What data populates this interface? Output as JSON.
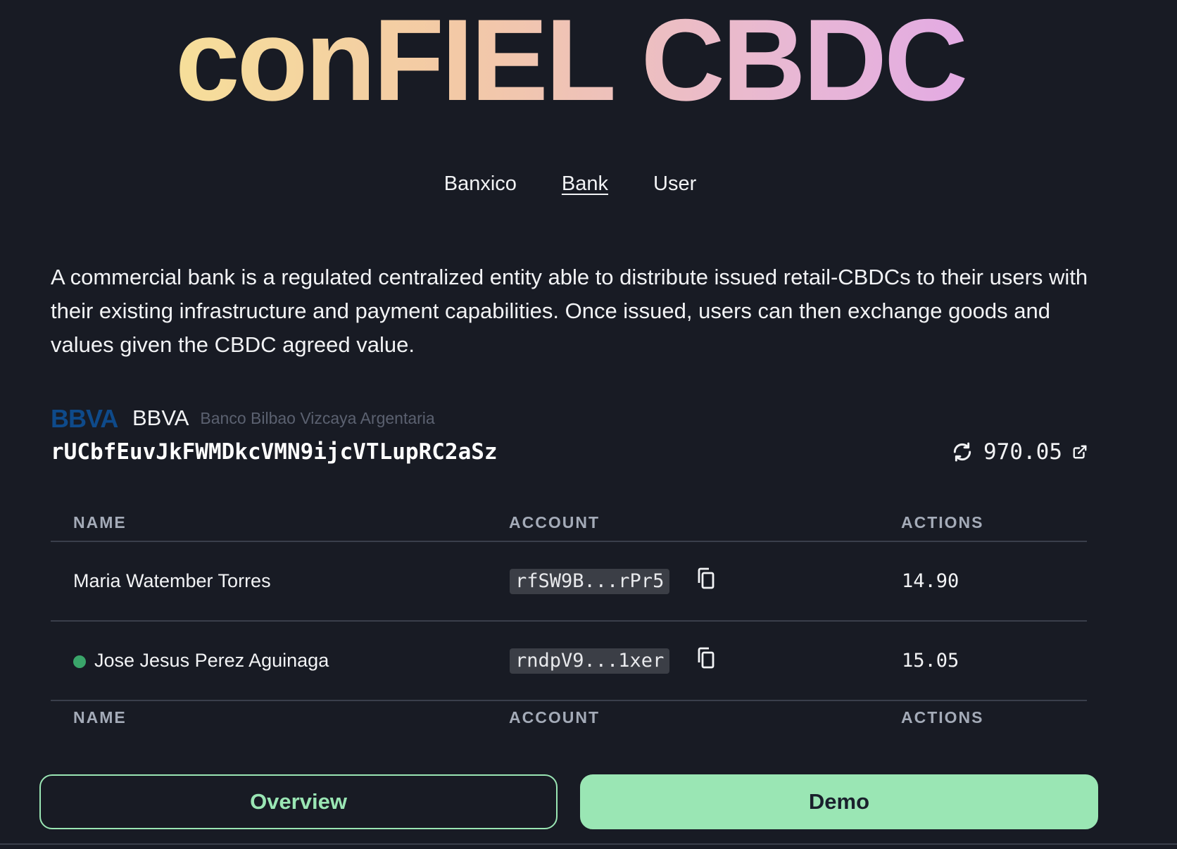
{
  "header": {
    "title": "conFIEL CBDC"
  },
  "nav": {
    "items": [
      {
        "label": "Banxico",
        "active": false
      },
      {
        "label": "Bank",
        "active": true
      },
      {
        "label": "User",
        "active": false
      }
    ]
  },
  "description": "A commercial bank is a regulated centralized entity able to distribute issued retail-CBDCs to their users with their existing infrastructure and payment capabilities. Once issued, users can then exchange goods and values given the CBDC agreed value.",
  "bank": {
    "logo_text": "BBVA",
    "name": "BBVA",
    "full_name": "Banco Bilbao Vizcaya Argentaria",
    "address": "rUCbfEuvJkFWMDkcVMN9ijcVTLupRC2aSz",
    "balance": "970.05",
    "logo_color": "#0e4a8a"
  },
  "table": {
    "headers": {
      "name": "NAME",
      "account": "ACCOUNT",
      "actions": "ACTIONS"
    },
    "rows": [
      {
        "name": "Maria Watember Torres",
        "account": "rfSW9B...rPr5",
        "amount": "14.90",
        "online": false
      },
      {
        "name": "Jose Jesus Perez Aguinaga",
        "account": "rndpV9...1xer",
        "amount": "15.05",
        "online": true
      }
    ]
  },
  "buttons": {
    "overview_label": "Overview",
    "demo_label": "Demo",
    "accent_color": "#9ae6b4"
  },
  "icons": {
    "refresh": "refresh-icon",
    "external_link": "external-link-icon",
    "copy": "copy-icon",
    "status": "status-dot-icon"
  }
}
